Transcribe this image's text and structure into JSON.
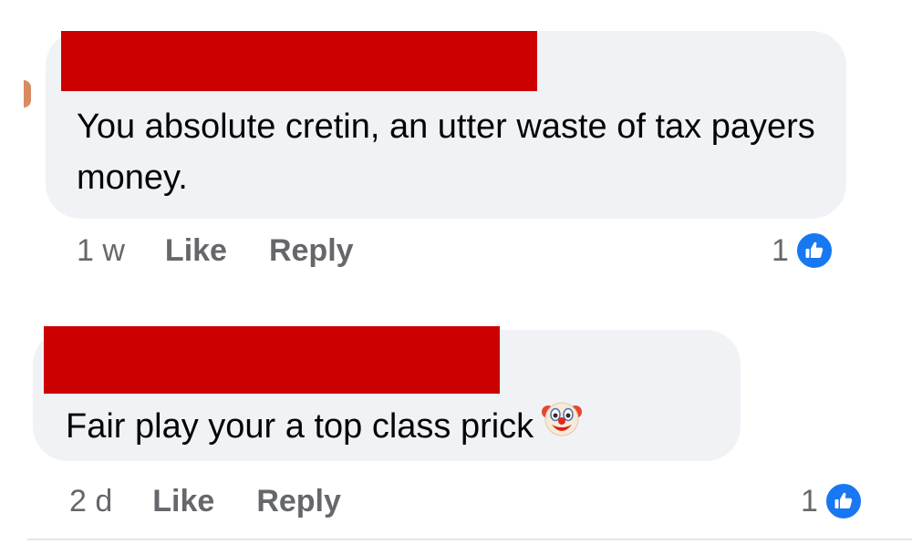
{
  "comments": [
    {
      "author_redacted": true,
      "text": "You absolute cretin, an utter waste of tax payers money.",
      "time": "1 w",
      "like_label": "Like",
      "reply_label": "Reply",
      "like_count": "1",
      "reaction_icon": "thumbs-up-icon"
    },
    {
      "author_redacted": true,
      "text": "Fair play your a top class prick",
      "emoji": "clown-face-icon",
      "time": "2 d",
      "like_label": "Like",
      "reply_label": "Reply",
      "like_count": "1",
      "reaction_icon": "thumbs-up-icon"
    }
  ],
  "colors": {
    "bubble": "#f0f2f5",
    "redaction": "#cc0000",
    "like_blue": "#1877f2",
    "meta_text": "#65676b",
    "body_text": "#050505"
  }
}
